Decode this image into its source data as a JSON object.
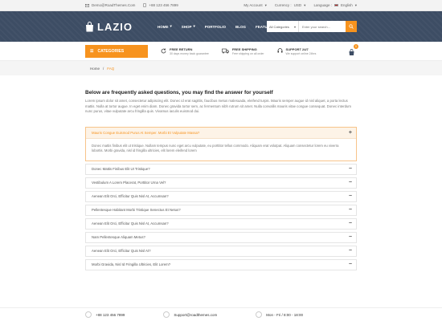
{
  "topbar": {
    "email": "Demo@RoadThemes.Com",
    "phone": "+88 123 456 7899",
    "account": "My Account",
    "currency_label": "Currency :",
    "currency_value": "USD",
    "language_label": "Language :",
    "language_value": "English"
  },
  "header": {
    "logo": "LAZIO",
    "nav": [
      {
        "label": "HOME"
      },
      {
        "label": "SHOP"
      },
      {
        "label": "PORTFOLIO"
      },
      {
        "label": "BLOG"
      },
      {
        "label": "FEATURES"
      }
    ],
    "search": {
      "category": "All Categories",
      "placeholder": "Enter your search..."
    }
  },
  "servicebar": {
    "categories_label": "CATEGORIES",
    "services": [
      {
        "title": "FREE RETURN",
        "subtitle": "30 days money back guarantee"
      },
      {
        "title": "FREE SHIPPING",
        "subtitle": "Free shipping on all order"
      },
      {
        "title": "SUPPORT 24/7",
        "subtitle": "We support online 24hrs"
      }
    ],
    "cart_count": "0"
  },
  "breadcrumb": {
    "home": "Home",
    "separator": "/",
    "current": "FAQ"
  },
  "faq_page": {
    "title": "Below are frequently asked questions, you may find the answer for yourself",
    "intro": "Lorem ipsum dolor sit amet, consectetur adipiscing elit. Donec id erat sagittis, faucibus metus malesuada, eleifend turpis. Mauris semper augue id nisl aliquet, a porta lectus mattis. Nulla at tortor augue. In eget enim diam. Donec gravida tortor sem, ac fermentum nibh rutrum sit amet. Nulla convallis mauris vitae congue consequat. Donec interdum nunc purus, vitae vulputate arcu fringilla quis. Vivamus iaculis euismod dui.",
    "items": [
      {
        "question": "Mauris Congue Euismod Purus At Semper. Morbi Et Vulputate Massa?",
        "answer": "Donec mattis finibus elit ut tristique. Nullam tempus nunc eget arcu vulputate, eu porttitor tellus commodo. Aliquam erat volutpat. Aliquam consectetur lorem eu viverra lobortis. Morbi gravida, nisl id fringilla ultricies, elit lorem eleifend lorem"
      },
      {
        "question": "Donec Mattis Finibus Elit Ut Tristique?"
      },
      {
        "question": "Vestibulum A Lorem Placerat, Porttitor Urna Vel?"
      },
      {
        "question": "Aenean Elit Orci, Efficitur Quis Nisl At, Accumsan?"
      },
      {
        "question": "Pellentesque Habitant Morbi Tristique Senectus Et Netus?"
      },
      {
        "question": "Aenean Elit Orci, Efficitur Quis Nisl At, Accumsan?"
      },
      {
        "question": "Nam Pellentesque Aliquam Metus?"
      },
      {
        "question": "Aenean Elit Orci, Efficitur Quis Nisl At?"
      },
      {
        "question": "Morbi Gravida, Nisl Id Fringilla Ultricies, Elit Lorem?"
      }
    ]
  },
  "footer": {
    "phone": "+88 123 456 7899",
    "email": "Support@roadthemes.com",
    "hours": "Mon - Fri / 8:00 - 18:00"
  },
  "colors": {
    "accent": "#f7931e",
    "header_bg": "#3d4d64"
  }
}
